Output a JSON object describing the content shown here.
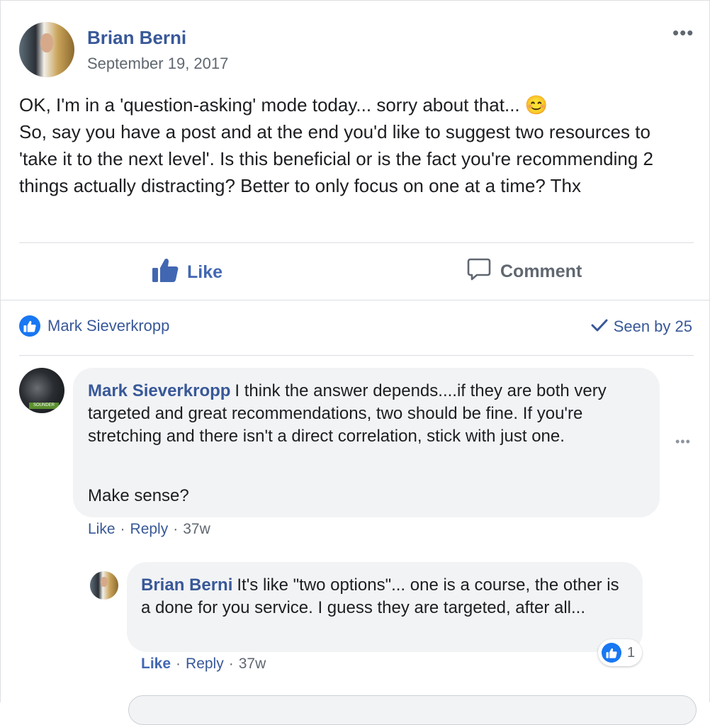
{
  "post": {
    "author": "Brian Berni",
    "date": "September 19, 2017",
    "menu_label": "•••",
    "text": "OK, I'm in a 'question-asking' mode today... sorry about that... 😊\nSo, say you have a post and at the end you'd like to suggest two resources to 'take it to the next level'. Is this beneficial or is the fact you're recommending 2 things actually distracting? Better to only focus on one at a time? Thx"
  },
  "actions": {
    "like_label": "Like",
    "comment_label": "Comment"
  },
  "summary": {
    "liker": "Mark Sieverkropp",
    "seen_by": "Seen by 25"
  },
  "comments": [
    {
      "author": "Mark Sieverkropp",
      "text": "I think the answer depends....if they are both very targeted and great recommendations, two should be fine. If you're stretching and there isn't a direct correlation, stick with just one.",
      "text2": "Make sense?",
      "like": "Like",
      "reply": "Reply",
      "time": "37w",
      "menu_label": "•••"
    },
    {
      "author": "Brian Berni",
      "text": "It's like \"two options\"... one is a course, the other is a done for you service. I guess they are targeted, after all...",
      "like": "Like",
      "reply": "Reply",
      "time": "37w",
      "reaction_count": "1"
    }
  ],
  "colors": {
    "link_blue": "#385898",
    "like_blue": "#4267b2",
    "bubble_bg": "#f2f3f5",
    "meta_gray": "#606770"
  }
}
